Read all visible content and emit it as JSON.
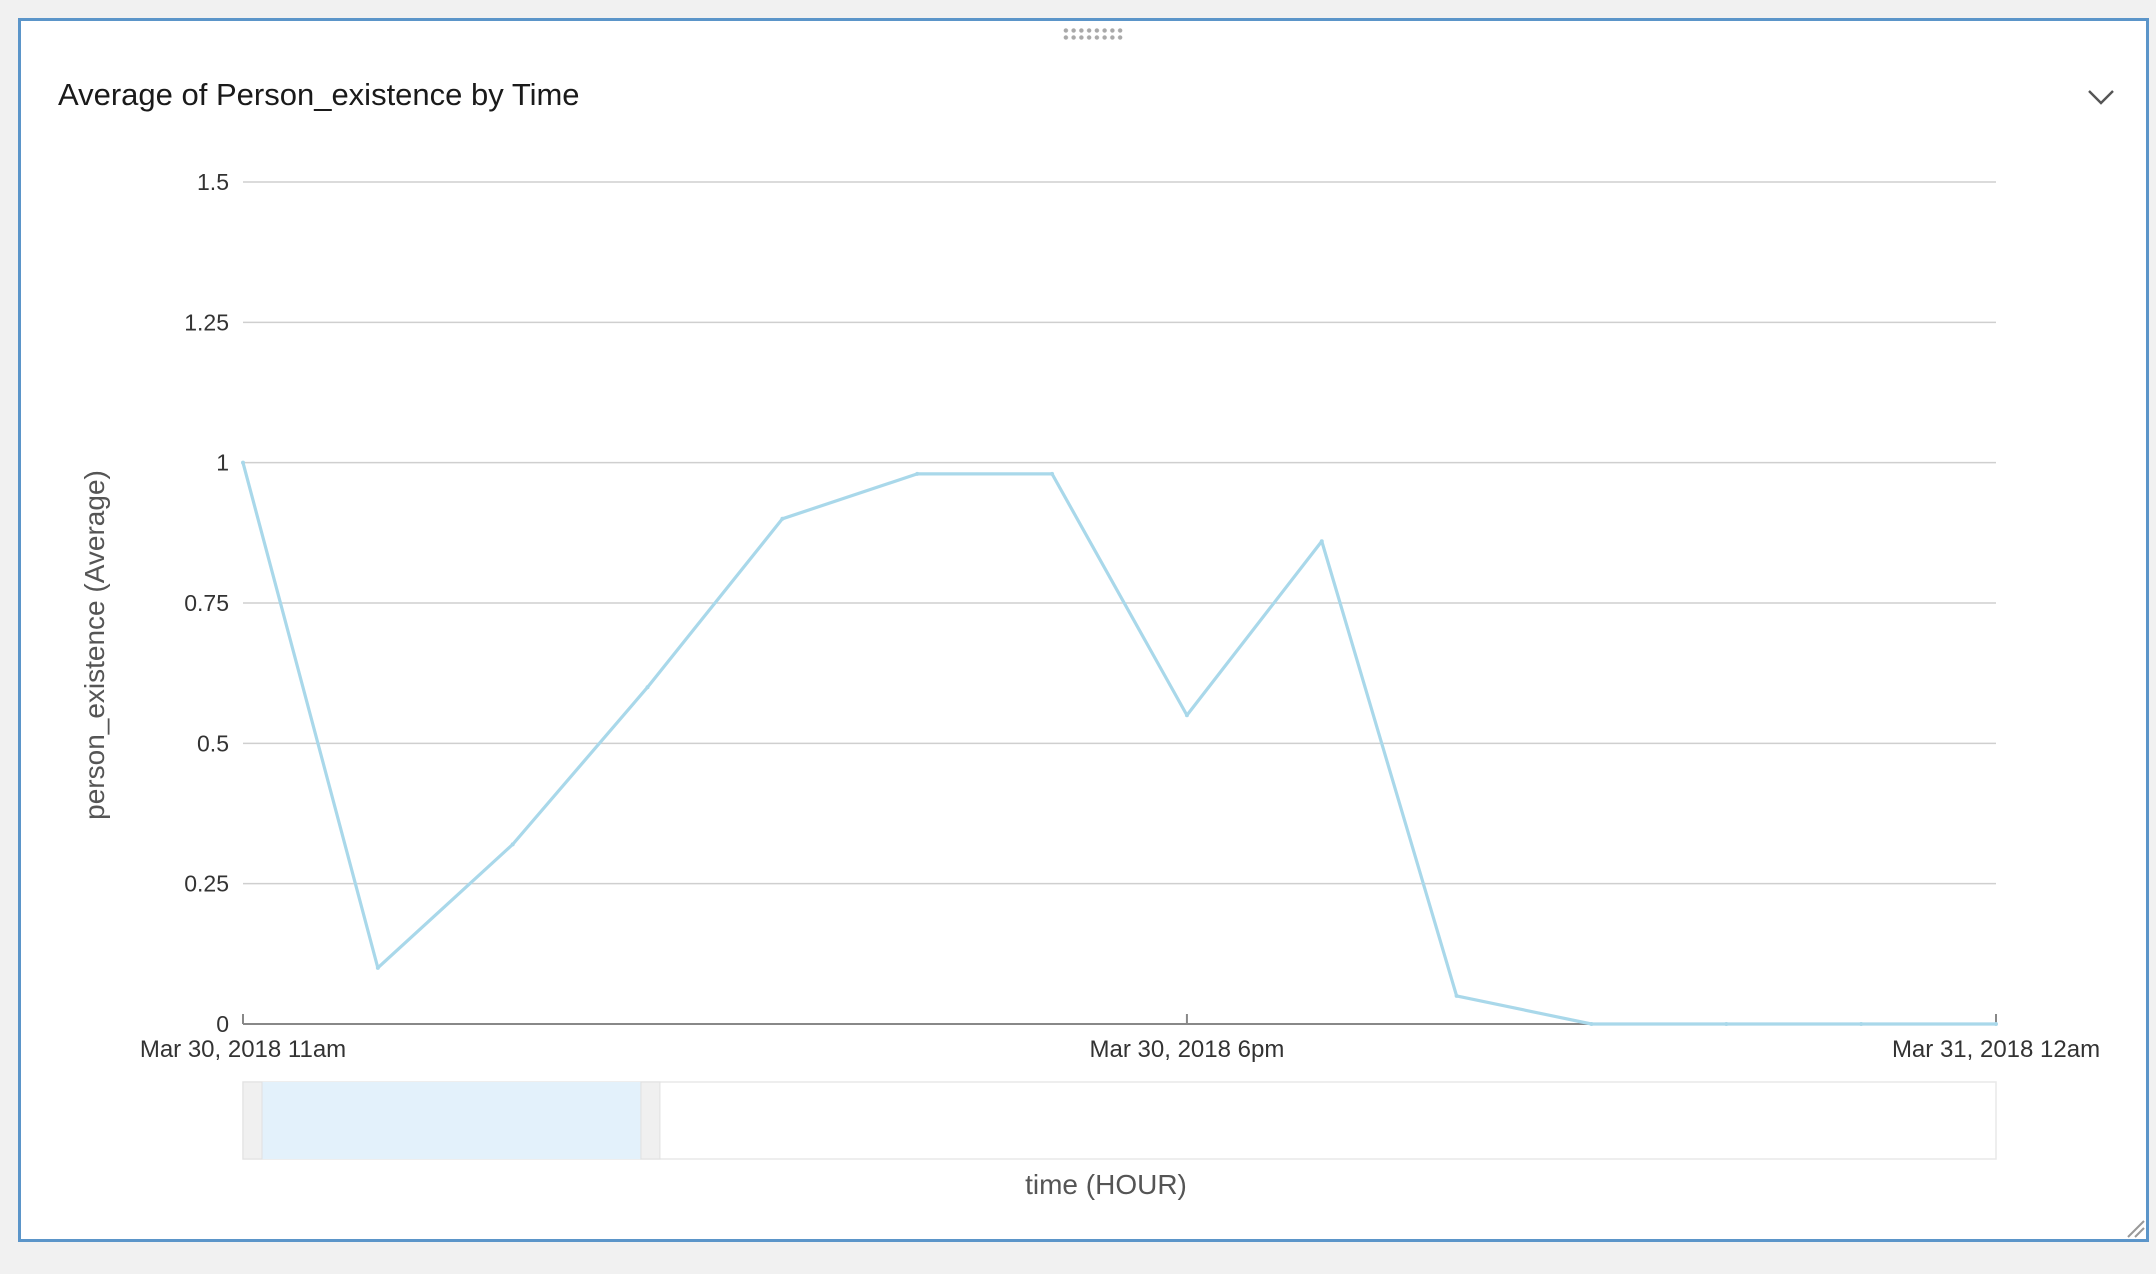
{
  "panel": {
    "title": "Average of Person_existence by Time"
  },
  "icons": {
    "drag_handle": "drag-handle-icon",
    "collapse": "chevron-down-icon",
    "resize": "resize-grip-icon"
  },
  "colors": {
    "line": "#a9d8ea",
    "border": "#5b95c9",
    "grid": "#cfcfcf",
    "brush_fill": "#e3f1fb"
  },
  "chart_data": {
    "type": "line",
    "title": "Average of Person_existence by Time",
    "xlabel": "time (HOUR)",
    "ylabel": "person_existence (Average)",
    "x": [
      "2018-03-30 11:00",
      "2018-03-30 12:00",
      "2018-03-30 13:00",
      "2018-03-30 14:00",
      "2018-03-30 15:00",
      "2018-03-30 16:00",
      "2018-03-30 17:00",
      "2018-03-30 18:00",
      "2018-03-30 19:00",
      "2018-03-30 20:00",
      "2018-03-30 21:00",
      "2018-03-30 22:00",
      "2018-03-30 23:00",
      "2018-03-31 00:00"
    ],
    "series": [
      {
        "values": [
          1.0,
          0.1,
          0.32,
          0.6,
          0.9,
          0.98,
          0.98,
          0.55,
          0.86,
          0.05,
          0.0,
          0.0,
          0.0,
          0.0
        ]
      }
    ],
    "ylim": [
      0,
      1.5
    ],
    "yticks": [
      "0",
      "0.25",
      "0.5",
      "0.75",
      "1",
      "1.25",
      "1.5"
    ],
    "xticks": [
      "Mar 30, 2018 11am",
      "Mar 30, 2018 6pm",
      "Mar 31, 2018 12am"
    ],
    "grid": true,
    "legend": "none",
    "brush_selection": [
      0.0,
      0.227
    ]
  }
}
